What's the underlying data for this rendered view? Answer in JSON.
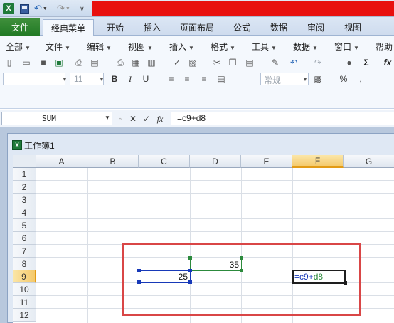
{
  "quick_access": {
    "logo": "X",
    "icons": [
      "excel-logo-icon",
      "save-icon",
      "undo-icon",
      "redo-icon",
      "customize-icon"
    ],
    "brand_bar_color": "#e8100e"
  },
  "tabs": {
    "file": "文件",
    "items": [
      "经典菜单",
      "开始",
      "插入",
      "页面布局",
      "公式",
      "数据",
      "审阅",
      "视图"
    ],
    "active": "经典菜单"
  },
  "menu": {
    "items": [
      "全部",
      "文件",
      "编辑",
      "视图",
      "插入",
      "格式",
      "工具",
      "数据",
      "窗口",
      "帮助"
    ]
  },
  "toolbar": {
    "font_size": "11",
    "bold": "B",
    "italic": "I",
    "underline": "U",
    "number_format": "常规",
    "sigma": "Σ",
    "fx": "fx",
    "percent": "%",
    "comma": ","
  },
  "formula_bar": {
    "name_box": "SUM",
    "cancel": "✕",
    "enter": "✓",
    "fx": "fx",
    "formula": "=c9+d8"
  },
  "workbook": {
    "title": "工作簿1",
    "columns": [
      "A",
      "B",
      "C",
      "D",
      "E",
      "F",
      "G"
    ],
    "rows": [
      "1",
      "2",
      "3",
      "4",
      "5",
      "6",
      "7",
      "8",
      "9",
      "10",
      "11",
      "12"
    ],
    "selected_column": "F",
    "selected_row": "9",
    "cells": {
      "D8": "35",
      "C9": "25"
    },
    "editing": {
      "ref_c9": "=c9+",
      "ref_d8": "d8"
    }
  },
  "colors": {
    "ref_c9": "#1739b8",
    "ref_d8": "#2c8a3c",
    "highlight": "#d94646",
    "header_selected": "#f4c96b"
  }
}
